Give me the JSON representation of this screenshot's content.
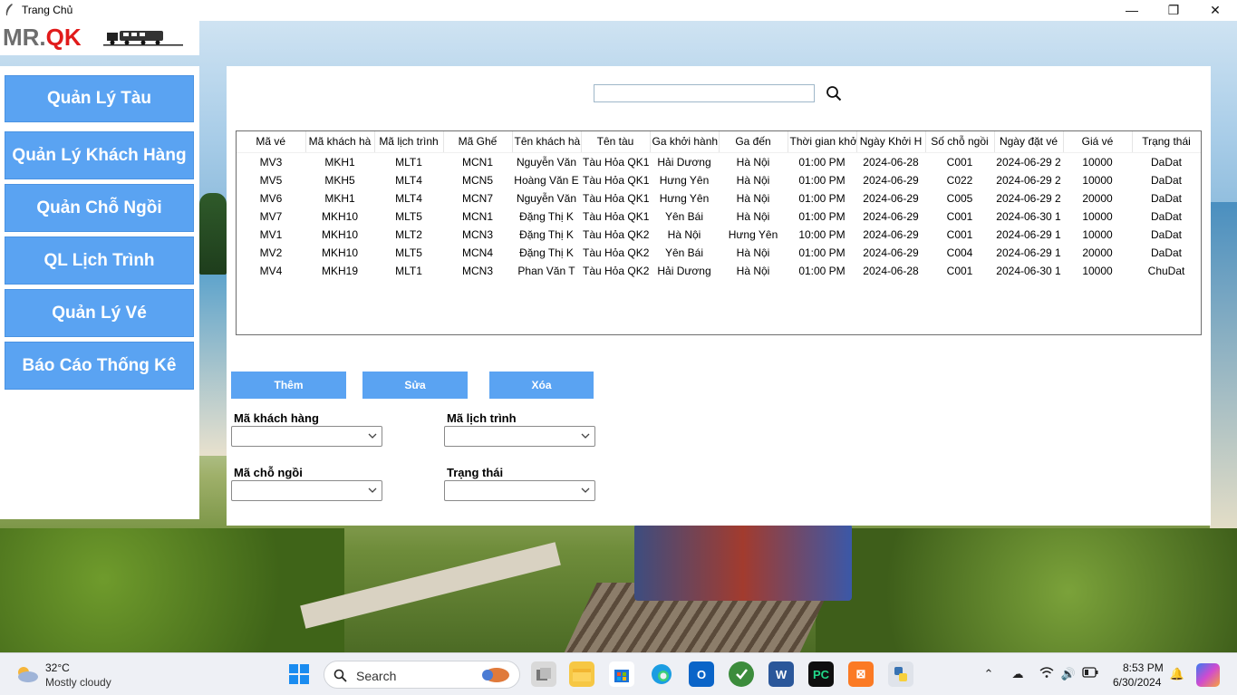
{
  "window": {
    "title": "Trang Chủ",
    "minimize_icon": "—",
    "maximize_icon": "❐",
    "close_icon": "✕"
  },
  "logo": {
    "text_mr": "MR.",
    "text_qk": "QK"
  },
  "sidebar": {
    "items": [
      {
        "label": "Quản Lý Tàu"
      },
      {
        "label": "Quản Lý Khách Hàng"
      },
      {
        "label": "Quản Chỗ Ngồi"
      },
      {
        "label": "QL Lịch Trình"
      },
      {
        "label": "Quản Lý Vé"
      },
      {
        "label": "Báo Cáo Thống Kê"
      }
    ]
  },
  "search": {
    "value": "",
    "placeholder": ""
  },
  "table": {
    "columns": [
      "Mã vé",
      "Mã khách hà",
      "Mã lịch trình",
      "Mã Ghế",
      "Tên khách hà",
      "Tên tàu",
      "Ga khởi hành",
      "Ga đến",
      "Thời gian khở",
      "Ngày Khởi H",
      "Số chỗ ngồi",
      "Ngày đặt vé",
      "Giá vé",
      "Trạng thái"
    ],
    "rows": [
      [
        "MV3",
        "MKH1",
        "MLT1",
        "MCN1",
        "Nguyễn Văn",
        "Tàu Hỏa QK1",
        "Hải Dương",
        "Hà Nội",
        "01:00 PM",
        "2024-06-28",
        "C001",
        "2024-06-29 2",
        "10000",
        "DaDat"
      ],
      [
        "MV5",
        "MKH5",
        "MLT4",
        "MCN5",
        "Hoàng Văn E",
        "Tàu Hỏa QK1",
        "Hưng Yên",
        "Hà Nội",
        "01:00 PM",
        "2024-06-29",
        "C022",
        "2024-06-29 2",
        "10000",
        "DaDat"
      ],
      [
        "MV6",
        "MKH1",
        "MLT4",
        "MCN7",
        "Nguyễn Văn",
        "Tàu Hỏa QK1",
        "Hưng Yên",
        "Hà Nội",
        "01:00 PM",
        "2024-06-29",
        "C005",
        "2024-06-29 2",
        "20000",
        "DaDat"
      ],
      [
        "MV7",
        "MKH10",
        "MLT5",
        "MCN1",
        "Đặng Thị K",
        "Tàu Hỏa QK1",
        "Yên Bái",
        "Hà Nội",
        "01:00 PM",
        "2024-06-29",
        "C001",
        "2024-06-30 1",
        "10000",
        "DaDat"
      ],
      [
        "MV1",
        "MKH10",
        "MLT2",
        "MCN3",
        "Đặng Thị K",
        "Tàu Hỏa QK2",
        "Hà Nội",
        "Hưng Yên",
        "10:00 PM",
        "2024-06-29",
        "C001",
        "2024-06-29 1",
        "10000",
        "DaDat"
      ],
      [
        "MV2",
        "MKH10",
        "MLT5",
        "MCN4",
        "Đặng Thị K",
        "Tàu Hỏa QK2",
        "Yên Bái",
        "Hà Nội",
        "01:00 PM",
        "2024-06-29",
        "C004",
        "2024-06-29 1",
        "20000",
        "DaDat"
      ],
      [
        "MV4",
        "MKH19",
        "MLT1",
        "MCN3",
        "Phan Văn T",
        "Tàu Hỏa QK2",
        "Hải Dương",
        "Hà Nội",
        "01:00 PM",
        "2024-06-28",
        "C001",
        "2024-06-30 1",
        "10000",
        "ChuDat"
      ]
    ]
  },
  "actions": {
    "add": "Thêm",
    "edit": "Sửa",
    "delete": "Xóa"
  },
  "form": {
    "customer_label": "Mã khách hàng",
    "schedule_label": "Mã lịch trình",
    "seat_label": "Mã chỗ ngồi",
    "status_label": "Trạng thái",
    "customer_value": "",
    "schedule_value": "",
    "seat_value": "",
    "status_value": ""
  },
  "taskbar": {
    "weather_temp": "32°C",
    "weather_desc": "Mostly cloudy",
    "search_label": "Search",
    "time": "8:53 PM",
    "date": "6/30/2024",
    "apps": [
      "windows-start-icon",
      "task-view-icon",
      "file-explorer-icon",
      "store-icon",
      "edge-icon",
      "outlook-icon",
      "app-green-icon",
      "word-icon",
      "pycharm-icon",
      "xampp-icon",
      "python-icon"
    ]
  },
  "colors": {
    "accent": "#5aa3f2",
    "logo_red": "#e11b1b",
    "logo_gray": "#6e6e6e"
  }
}
